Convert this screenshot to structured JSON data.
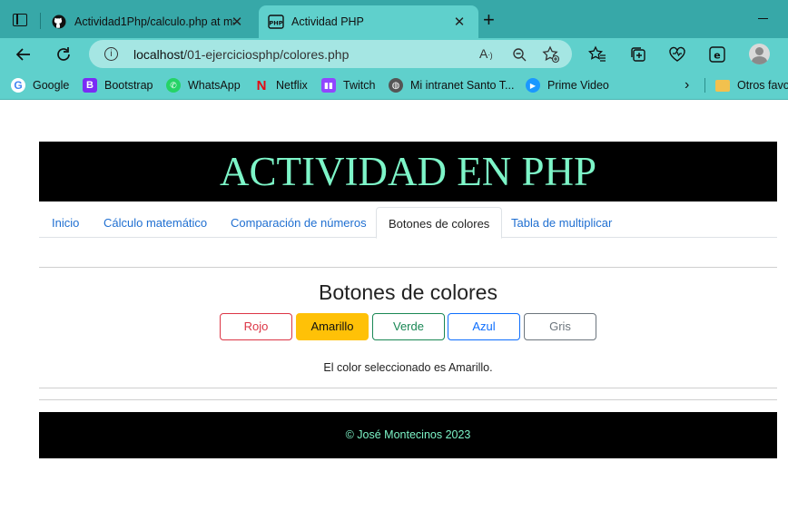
{
  "browser": {
    "tabs": [
      {
        "title": "Actividad1Php/calculo.php at ma",
        "icon": "github-icon"
      },
      {
        "title": "Actividad PHP",
        "icon": "php-icon"
      }
    ],
    "address": {
      "host": "localhost",
      "path": "/01-ejerciciosphp/colores.php"
    },
    "bookmarks": [
      {
        "label": "Google"
      },
      {
        "label": "Bootstrap"
      },
      {
        "label": "WhatsApp"
      },
      {
        "label": "Netflix"
      },
      {
        "label": "Twitch"
      },
      {
        "label": "Mi intranet Santo T..."
      },
      {
        "label": "Prime Video"
      },
      {
        "label": "Otros favo"
      }
    ]
  },
  "page": {
    "banner": "ACTIVIDAD EN PHP",
    "nav": [
      "Inicio",
      "Cálculo matemático",
      "Comparación de números",
      "Botones de colores",
      "Tabla de multiplicar"
    ],
    "active_nav": "Botones de colores",
    "section_title": "Botones de colores",
    "buttons": [
      {
        "label": "Rojo",
        "color": "#dc3545"
      },
      {
        "label": "Amarillo",
        "color": "#ffc107"
      },
      {
        "label": "Verde",
        "color": "#198754"
      },
      {
        "label": "Azul",
        "color": "#0d6efd"
      },
      {
        "label": "Gris",
        "color": "#6c757d"
      }
    ],
    "message": "El color seleccionado es Amarillo.",
    "footer": "© José Montecinos 2023"
  },
  "colors": {
    "browser_bg": "#37a8a8",
    "toolbar_bg": "#5fd0cc",
    "banner_text": "#7df5c8"
  }
}
